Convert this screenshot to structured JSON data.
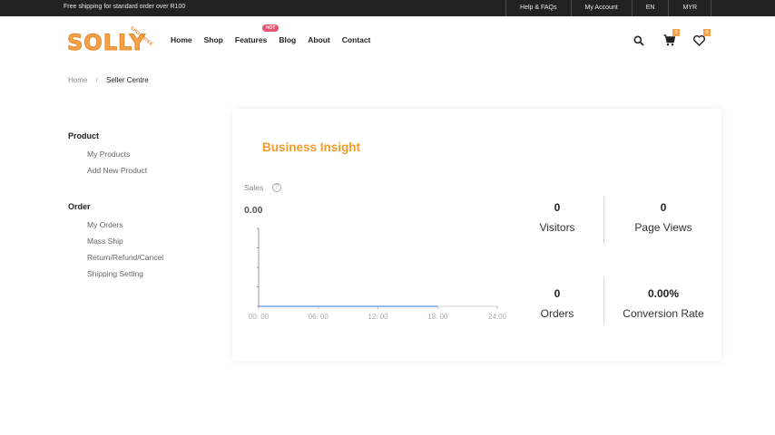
{
  "topbar": {
    "promo": "Free shipping for standard order over R100",
    "links": [
      "Help & FAQs",
      "My Account",
      "EN",
      "MYR"
    ]
  },
  "logo": {
    "word": "SOLLY",
    "sub": "SHOPWISE"
  },
  "nav": {
    "items": [
      "Home",
      "Shop",
      "Features",
      "Blog",
      "About",
      "Contact"
    ],
    "hot_badge": "HOT"
  },
  "header_icons": {
    "search": "search-icon",
    "cart": "cart-icon",
    "cart_count": "3",
    "wishlist": "heart-icon",
    "wishlist_count": "0"
  },
  "breadcrumb": {
    "home": "Home",
    "separator": "/",
    "current": "Seller Centre"
  },
  "sidebar": {
    "product_heading": "Product",
    "product_items": [
      "My Products",
      "Add New Product"
    ],
    "order_heading": "Order",
    "order_items": [
      "My Orders",
      "Mass Ship",
      "Return/Refund/Cancel",
      "Shipping Setting"
    ]
  },
  "insight": {
    "title": "Business Insight",
    "sales_label": "Sales",
    "sales_value": "0.00",
    "stats": [
      {
        "value": "0",
        "label": "Visitors"
      },
      {
        "value": "0",
        "label": "Page Views"
      },
      {
        "value": "0",
        "label": "Orders"
      },
      {
        "value": "0.00%",
        "label": "Conversion Rate"
      }
    ]
  },
  "chart_data": {
    "type": "line",
    "x": [
      "00: 00",
      "06: 00",
      "12: 00",
      "18: 00",
      "24:00"
    ],
    "series": [
      {
        "values": [
          0,
          0,
          0,
          0
        ]
      }
    ],
    "title": "",
    "xlabel": "",
    "ylabel": "",
    "grid": false
  },
  "colors": {
    "accent": "#f29c2b",
    "topbar_bg": "#222222",
    "hot_badge": "#e3566f",
    "line": "#7ea3e8"
  }
}
